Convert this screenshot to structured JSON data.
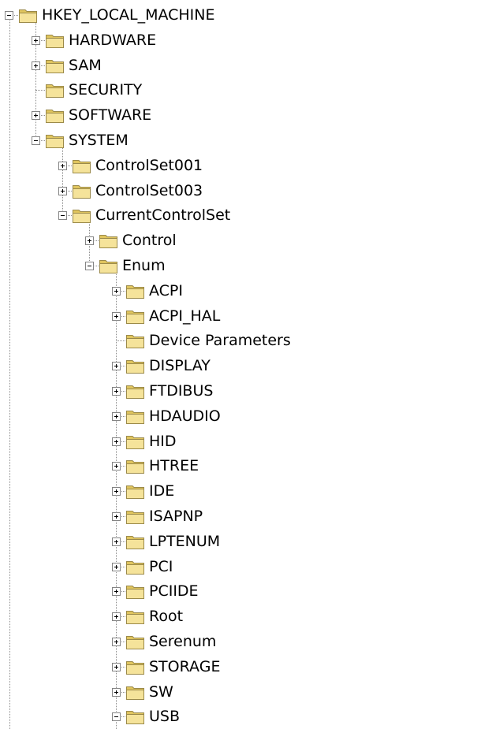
{
  "tree": {
    "nodes": [
      {
        "label": "HKEY_LOCAL_MACHINE",
        "depth": 0,
        "expander": "minus"
      },
      {
        "label": "HARDWARE",
        "depth": 1,
        "expander": "plus"
      },
      {
        "label": "SAM",
        "depth": 1,
        "expander": "plus"
      },
      {
        "label": "SECURITY",
        "depth": 1,
        "expander": "none"
      },
      {
        "label": "SOFTWARE",
        "depth": 1,
        "expander": "plus"
      },
      {
        "label": "SYSTEM",
        "depth": 1,
        "expander": "minus"
      },
      {
        "label": "ControlSet001",
        "depth": 2,
        "expander": "plus"
      },
      {
        "label": "ControlSet003",
        "depth": 2,
        "expander": "plus"
      },
      {
        "label": "CurrentControlSet",
        "depth": 2,
        "expander": "minus"
      },
      {
        "label": "Control",
        "depth": 3,
        "expander": "plus"
      },
      {
        "label": "Enum",
        "depth": 3,
        "expander": "minus"
      },
      {
        "label": "ACPI",
        "depth": 4,
        "expander": "plus"
      },
      {
        "label": "ACPI_HAL",
        "depth": 4,
        "expander": "plus"
      },
      {
        "label": "Device Parameters",
        "depth": 4,
        "expander": "none"
      },
      {
        "label": "DISPLAY",
        "depth": 4,
        "expander": "plus"
      },
      {
        "label": "FTDIBUS",
        "depth": 4,
        "expander": "plus"
      },
      {
        "label": "HDAUDIO",
        "depth": 4,
        "expander": "plus"
      },
      {
        "label": "HID",
        "depth": 4,
        "expander": "plus"
      },
      {
        "label": "HTREE",
        "depth": 4,
        "expander": "plus"
      },
      {
        "label": "IDE",
        "depth": 4,
        "expander": "plus"
      },
      {
        "label": "ISAPNP",
        "depth": 4,
        "expander": "plus"
      },
      {
        "label": "LPTENUM",
        "depth": 4,
        "expander": "plus"
      },
      {
        "label": "PCI",
        "depth": 4,
        "expander": "plus"
      },
      {
        "label": "PCIIDE",
        "depth": 4,
        "expander": "plus"
      },
      {
        "label": "Root",
        "depth": 4,
        "expander": "plus"
      },
      {
        "label": "Serenum",
        "depth": 4,
        "expander": "plus"
      },
      {
        "label": "STORAGE",
        "depth": 4,
        "expander": "plus"
      },
      {
        "label": "SW",
        "depth": 4,
        "expander": "plus"
      },
      {
        "label": "USB",
        "depth": 4,
        "expander": "minus"
      }
    ]
  },
  "icons": {
    "node": "folder-icon",
    "expand": "plus-icon",
    "collapse": "minus-icon"
  },
  "colors": {
    "tree_line": "#8c8c8c",
    "folder_fill": "#f5e39a",
    "folder_shade": "#e0c55e",
    "folder_outline": "#9b8a4a",
    "expander_border": "#848484"
  }
}
